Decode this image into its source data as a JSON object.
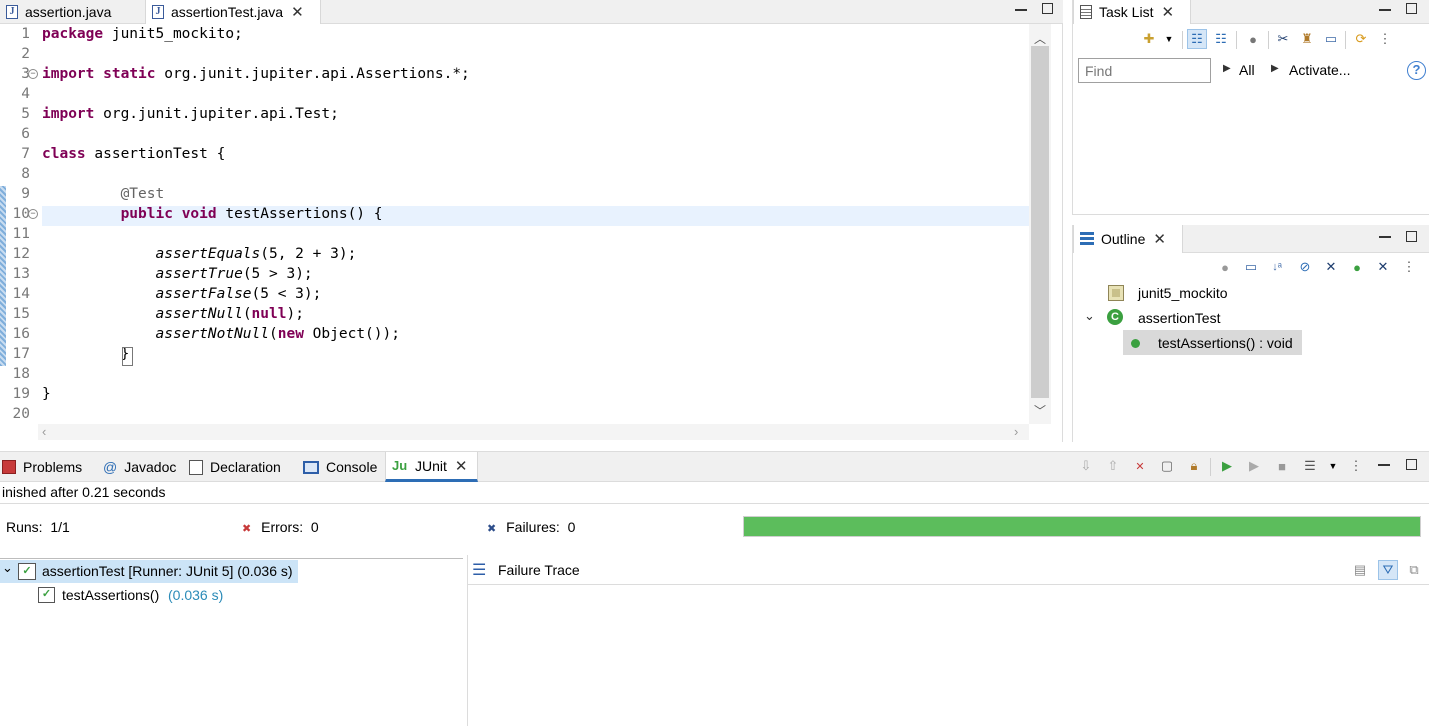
{
  "editor": {
    "tabs": [
      {
        "label": "assertion.java"
      },
      {
        "label": "assertionTest.java"
      }
    ],
    "lines": [
      {
        "n": "1",
        "html": "<span class=\"kw\">package</span> junit5_mockito;"
      },
      {
        "n": "2",
        "html": ""
      },
      {
        "n": "3",
        "html": "<span class=\"kw\">import</span> <span class=\"kw\">static</span> org.junit.jupiter.api.Assertions.*;"
      },
      {
        "n": "4",
        "html": ""
      },
      {
        "n": "5",
        "html": "<span class=\"kw\">import</span> org.junit.jupiter.api.Test;"
      },
      {
        "n": "6",
        "html": ""
      },
      {
        "n": "7",
        "html": "<span class=\"kw\">class</span> assertionTest {"
      },
      {
        "n": "8",
        "html": ""
      },
      {
        "n": "9",
        "html": "\t<span class=\"ann\">@Test</span>"
      },
      {
        "n": "10",
        "html": "\t<span class=\"kw\">public</span> <span class=\"kw\">void</span> testAssertions() {"
      },
      {
        "n": "11",
        "html": ""
      },
      {
        "n": "12",
        "html": "\t    <span class=\"it\">assertEquals</span>(5, 2 + 3);"
      },
      {
        "n": "13",
        "html": "\t    <span class=\"it\">assertTrue</span>(5 > 3);"
      },
      {
        "n": "14",
        "html": "\t    <span class=\"it\">assertFalse</span>(5 < 3);"
      },
      {
        "n": "15",
        "html": "\t    <span class=\"it\">assertNull</span>(<span class=\"kw\">null</span>);"
      },
      {
        "n": "16",
        "html": "\t    <span class=\"it\">assertNotNull</span>(<span class=\"kw\">new</span> Object());"
      },
      {
        "n": "17",
        "html": "\t}"
      },
      {
        "n": "18",
        "html": ""
      },
      {
        "n": "19",
        "html": "}"
      },
      {
        "n": "20",
        "html": ""
      }
    ]
  },
  "tasklist": {
    "tab": "Task List",
    "find_placeholder": "Find",
    "all_label": "All",
    "activate_label": "Activate..."
  },
  "outline": {
    "tab": "Outline",
    "package": "junit5_mockito",
    "class": "assertionTest",
    "method": "testAssertions() : void"
  },
  "bottom": {
    "tabs": [
      {
        "label": "Problems"
      },
      {
        "label": "Javadoc"
      },
      {
        "label": "Declaration"
      },
      {
        "label": "Console"
      },
      {
        "label": "JUnit"
      }
    ],
    "status": "inished after 0.21 seconds",
    "runs_label": "Runs:",
    "runs_value": "1/1",
    "errors_label": "Errors:",
    "errors_value": "0",
    "failures_label": "Failures:",
    "failures_value": "0",
    "progress_fraction": 1.0,
    "progress_color": "#5cbd5c",
    "tree_root": "assertionTest [Runner: JUnit 5] (0.036 s)",
    "tree_child_name": "testAssertions()",
    "tree_child_time": "(0.036 s)",
    "failure_trace": "Failure Trace"
  }
}
